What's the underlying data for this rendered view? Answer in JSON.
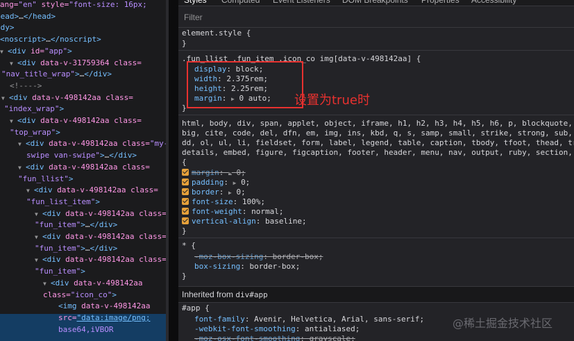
{
  "dom_tree": [
    {
      "parts": [
        [
          "an",
          "l lang="
        ],
        [
          "av",
          "\"en\""
        ],
        [
          "an",
          " style="
        ],
        [
          "av",
          "\"font-size: 16px;"
        ]
      ]
    },
    {
      "parts": [
        [
          "tag",
          "head>"
        ],
        [
          "tx",
          "…"
        ],
        [
          "tag",
          "</head>"
        ]
      ]
    },
    {
      "parts": [
        [
          "tag",
          "ody>"
        ]
      ]
    },
    {
      "parts": [
        [
          "tag",
          "<noscript>"
        ],
        [
          "tx",
          "…"
        ],
        [
          "tag",
          "</noscript>"
        ]
      ]
    },
    {
      "parts": [
        [
          "tag",
          "<div "
        ],
        [
          "an",
          "id="
        ],
        [
          "av",
          "\"app\""
        ],
        [
          "tag",
          ">"
        ]
      ]
    },
    {
      "parts": [
        [
          "tag",
          "<div "
        ],
        [
          "an",
          "data-v-31759364 class="
        ]
      ]
    },
    {
      "parts": [
        [
          "av",
          "\"nav_title_wrap\""
        ],
        [
          "tag",
          ">"
        ],
        [
          "tx",
          "…"
        ],
        [
          "tag",
          "</div>"
        ]
      ]
    },
    {
      "parts": [
        [
          "cm",
          "<!---->"
        ]
      ]
    },
    {
      "parts": [
        [
          "tag",
          "<div "
        ],
        [
          "an",
          "data-v-498142aa class="
        ]
      ]
    },
    {
      "parts": [
        [
          "av",
          "\"index_wrap\""
        ],
        [
          "tag",
          ">"
        ]
      ]
    },
    {
      "parts": [
        [
          "tag",
          "<div "
        ],
        [
          "an",
          "data-v-498142aa class="
        ]
      ]
    },
    {
      "parts": [
        [
          "av",
          "\"top_wrap\""
        ],
        [
          "tag",
          ">"
        ]
      ]
    },
    {
      "parts": [
        [
          "tag",
          "<div "
        ],
        [
          "an",
          "data-v-498142aa class="
        ],
        [
          "av",
          "\"my-"
        ]
      ]
    },
    {
      "parts": [
        [
          "av",
          "swipe van-swipe\""
        ],
        [
          "tag",
          ">"
        ],
        [
          "tx",
          "…"
        ],
        [
          "tag",
          "</div>"
        ]
      ]
    },
    {
      "parts": [
        [
          "tag",
          "<div "
        ],
        [
          "an",
          "data-v-498142aa class="
        ]
      ]
    },
    {
      "parts": [
        [
          "av",
          "\"fun_llist\""
        ],
        [
          "tag",
          ">"
        ]
      ]
    },
    {
      "parts": [
        [
          "tag",
          "<div "
        ],
        [
          "an",
          "data-v-498142aa class="
        ]
      ]
    },
    {
      "parts": [
        [
          "av",
          "\"fun_list_item\""
        ],
        [
          "tag",
          ">"
        ]
      ]
    },
    {
      "parts": [
        [
          "tag",
          "<div "
        ],
        [
          "an",
          "data-v-498142aa class="
        ]
      ]
    },
    {
      "parts": [
        [
          "av",
          "\"fun_item\""
        ],
        [
          "tag",
          ">"
        ],
        [
          "tx",
          "…"
        ],
        [
          "tag",
          "</div>"
        ]
      ]
    },
    {
      "parts": [
        [
          "tag",
          "<div "
        ],
        [
          "an",
          "data-v-498142aa class="
        ]
      ]
    },
    {
      "parts": [
        [
          "av",
          "\"fun_item\""
        ],
        [
          "tag",
          ">"
        ],
        [
          "tx",
          "…"
        ],
        [
          "tag",
          "</div>"
        ]
      ]
    },
    {
      "parts": [
        [
          "tag",
          "<div "
        ],
        [
          "an",
          "data-v-498142aa class="
        ]
      ]
    },
    {
      "parts": [
        [
          "av",
          "\"fun_item\""
        ],
        [
          "tag",
          ">"
        ]
      ]
    },
    {
      "parts": [
        [
          "tag",
          "<div "
        ],
        [
          "an",
          "data-v-498142aa"
        ]
      ]
    },
    {
      "parts": [
        [
          "an",
          "class="
        ],
        [
          "av",
          "\"icon_co\""
        ],
        [
          "tag",
          ">"
        ]
      ]
    },
    {
      "parts": [
        [
          "tag",
          "<img "
        ],
        [
          "an",
          "data-v-498142aa"
        ]
      ]
    },
    {
      "parts": [
        [
          "an",
          "src="
        ],
        [
          "lnk",
          "\"data:image/png;"
        ]
      ]
    },
    {
      "parts": [
        [
          "av",
          "base64,iVBOR"
        ]
      ]
    }
  ],
  "tabs": [
    "Styles",
    "Computed",
    "Event Listeners",
    "DOM Breakpoints",
    "Properties",
    "Accessibility"
  ],
  "filter": {
    "placeholder": "Filter"
  },
  "rules": {
    "element_style": {
      "selector": "element.style {",
      "close": "}"
    },
    "icon_rule": {
      "selector": ".fun_llist .fun_item .icon_co img[data-v-498142aa] {",
      "decls": [
        {
          "prop": "display",
          "value": "block;"
        },
        {
          "prop": "width",
          "value": "2.375rem;"
        },
        {
          "prop": "height",
          "value": "2.25rem;"
        },
        {
          "prop": "margin",
          "value": "0 auto;"
        }
      ],
      "close": "}"
    },
    "reset_rule": {
      "selector_lines": [
        "html, body, div, span, applet, object, iframe, h1, h2, h3, h4, h5, h6, p, blockquote,",
        "big, cite, code, del, dfn, em, img, ins, kbd, q, s, samp, small, strike, strong, sub,",
        "dd, ol, ul, li, fieldset, form, label, legend, table, caption, tbody, tfoot, thead, tr,",
        "details, embed, figure, figcaption, footer, header, menu, nav, output, ruby, section,",
        "{"
      ],
      "decls": [
        {
          "prop": "margin",
          "value": "0;"
        },
        {
          "prop": "padding",
          "value": "0;"
        },
        {
          "prop": "border",
          "value": "0;"
        },
        {
          "prop": "font-size",
          "value": "100%;"
        },
        {
          "prop": "font-weight",
          "value": "normal;"
        },
        {
          "prop": "vertical-align",
          "value": "baseline;"
        }
      ],
      "close": "}"
    },
    "universal_rule": {
      "selector": "* {",
      "decls": [
        {
          "prop": "-moz-box-sizing",
          "value": "border-box;"
        },
        {
          "prop": "box-sizing",
          "value": "border-box;"
        }
      ],
      "close": "}"
    },
    "inherited": {
      "label": "Inherited from",
      "element": "div#app"
    },
    "app_rule": {
      "selector": "#app {",
      "decls": [
        {
          "prop": "font-family",
          "value": "Avenir, Helvetica, Arial, sans-serif;"
        },
        {
          "prop": "-webkit-font-smoothing",
          "value": "antialiased;"
        },
        {
          "prop": "-moz-osx-font-smoothing",
          "value": "grayscale;"
        }
      ]
    }
  },
  "annotation": {
    "text": "设置为true时",
    "color": "#e8312f"
  },
  "watermark": "@稀土掘金技术社区"
}
